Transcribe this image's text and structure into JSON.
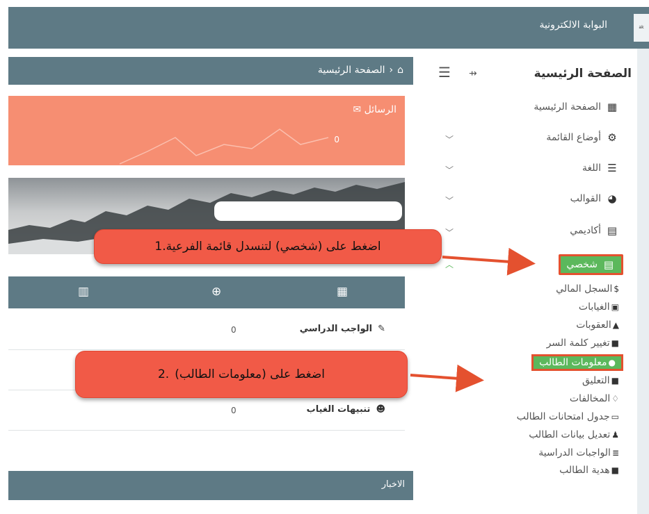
{
  "topbar": {
    "brand": "البوابة الالكترونية",
    "logo_text": "ak"
  },
  "sidebar": {
    "header": "الصفحة الرئيسية",
    "items": [
      {
        "label": "الصفحة الرئيسية",
        "icon": "dashboard-icon"
      },
      {
        "label": "أوضاع القائمة",
        "icon": "gear-icon"
      },
      {
        "label": "اللغة",
        "icon": "align-icon"
      },
      {
        "label": "القوالب",
        "icon": "palette-icon"
      },
      {
        "label": "أكاديمي",
        "icon": "message-icon"
      },
      {
        "label": "شخصي",
        "icon": "message-icon"
      }
    ],
    "subitems": [
      {
        "label": "السجل المالي",
        "icon": "$"
      },
      {
        "label": "الغيابات",
        "icon": "absence-icon"
      },
      {
        "label": "العقوبات",
        "icon": "warning-icon"
      },
      {
        "label": "تغيير كلمة السر",
        "icon": "lock-icon"
      },
      {
        "label": "معلومات الطالب",
        "icon": "user-icon"
      },
      {
        "label": "التعليق",
        "icon": "comment-icon"
      },
      {
        "label": "المخالفات",
        "icon": "thumbs-down-icon"
      },
      {
        "label": "جدول امتحانات الطالب",
        "icon": "calendar-icon"
      },
      {
        "label": "تعديل بيانات الطالب",
        "icon": "user-edit-icon"
      },
      {
        "label": "الواجبات الدراسية",
        "icon": "list-icon"
      },
      {
        "label": "هدية الطالب",
        "icon": "gift-icon"
      }
    ]
  },
  "breadcrumb": {
    "text": "الصفحة الرئيسية"
  },
  "messages": {
    "title": "الرسائل",
    "count": "0"
  },
  "rows": [
    {
      "label": "الواجب الدراسي",
      "value": "0",
      "icon": "edit-icon"
    },
    {
      "label": "",
      "value": "",
      "icon": ""
    },
    {
      "label": "تنبيهات الغياب",
      "value": "0",
      "icon": "users-icon"
    }
  ],
  "news": {
    "title": "الاخبار"
  },
  "callouts": {
    "step1": "اضغط على (شخصي) لتنسدل قائمة الفرعية.1",
    "step2": "اضغط على (معلومات الطالب)",
    "step2_num": ".2"
  },
  "colors": {
    "header": "#5e7a85",
    "messages_card": "#f68e72",
    "active_item": "#5cb85c",
    "callout": "#f15a47",
    "highlight_border": "#e4512f"
  }
}
